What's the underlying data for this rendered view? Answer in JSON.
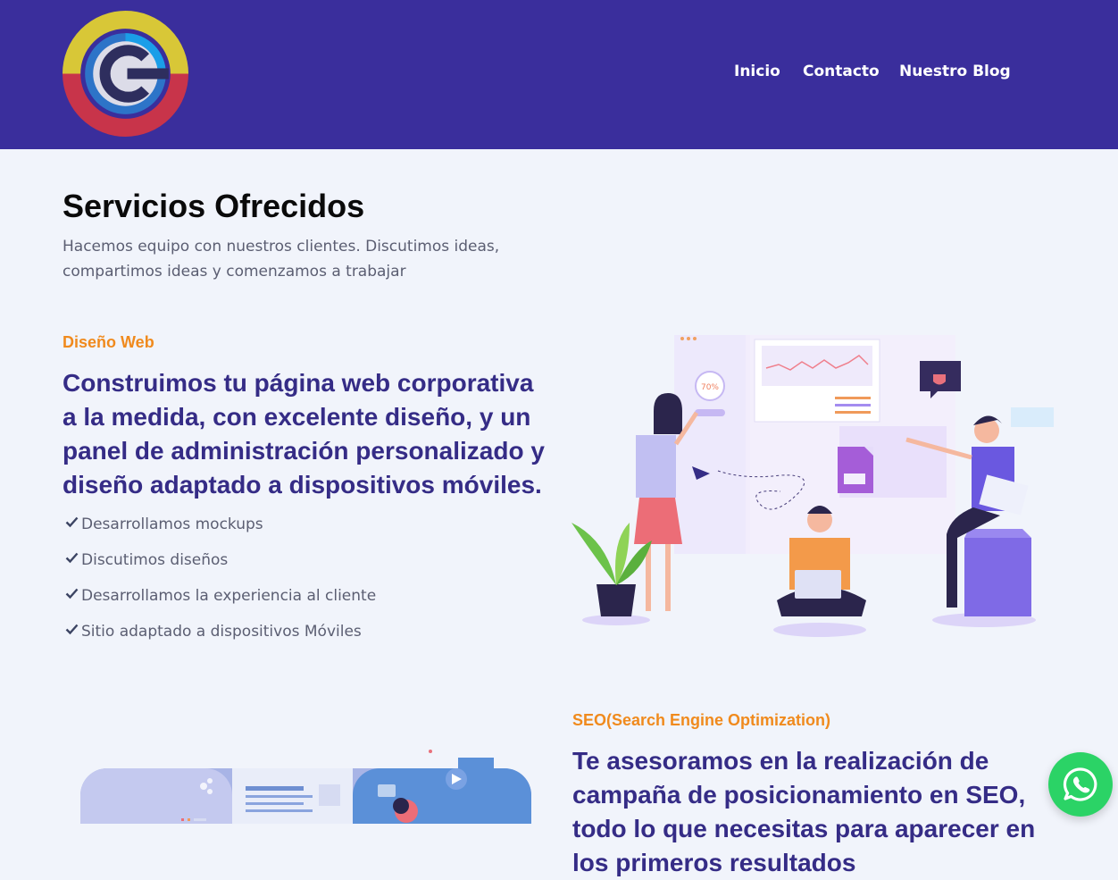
{
  "nav": {
    "items": [
      "Inicio",
      "Contacto",
      "Nuestro Blog"
    ]
  },
  "services": {
    "title": "Servicios Ofrecidos",
    "subtitle": "Hacemos equipo con nuestros clientes. Discutimos ideas, compartimos ideas y comenzamos a trabajar"
  },
  "web_design": {
    "kicker": "Diseño Web",
    "headline": "Construimos tu página web corporativa a la medida, con excelente diseño, y un panel de administración personalizado y diseño adaptado a dispositivos móviles.",
    "features": [
      "Desarrollamos mockups",
      "Discutimos diseños",
      "Desarrollamos la experiencia al cliente",
      "Sitio adaptado a dispositivos Móviles"
    ],
    "illustration_progress_label": "70%"
  },
  "seo": {
    "kicker": "SEO(Search Engine Optimization)",
    "headline": "Te asesoramos en la realización de campaña de posicionamiento en SEO, todo lo que necesitas para aparecer en los primeros resultados"
  },
  "icons": {
    "check": "check-icon",
    "whatsapp": "whatsapp-icon",
    "logo": "company-logo"
  },
  "colors": {
    "header_bg": "#3a2e9c",
    "page_bg": "#f1f4fb",
    "accent_orange": "#f08a1d",
    "headline_purple": "#352c86",
    "body_text": "#5b5e72",
    "whatsapp_green": "#2bd366"
  }
}
